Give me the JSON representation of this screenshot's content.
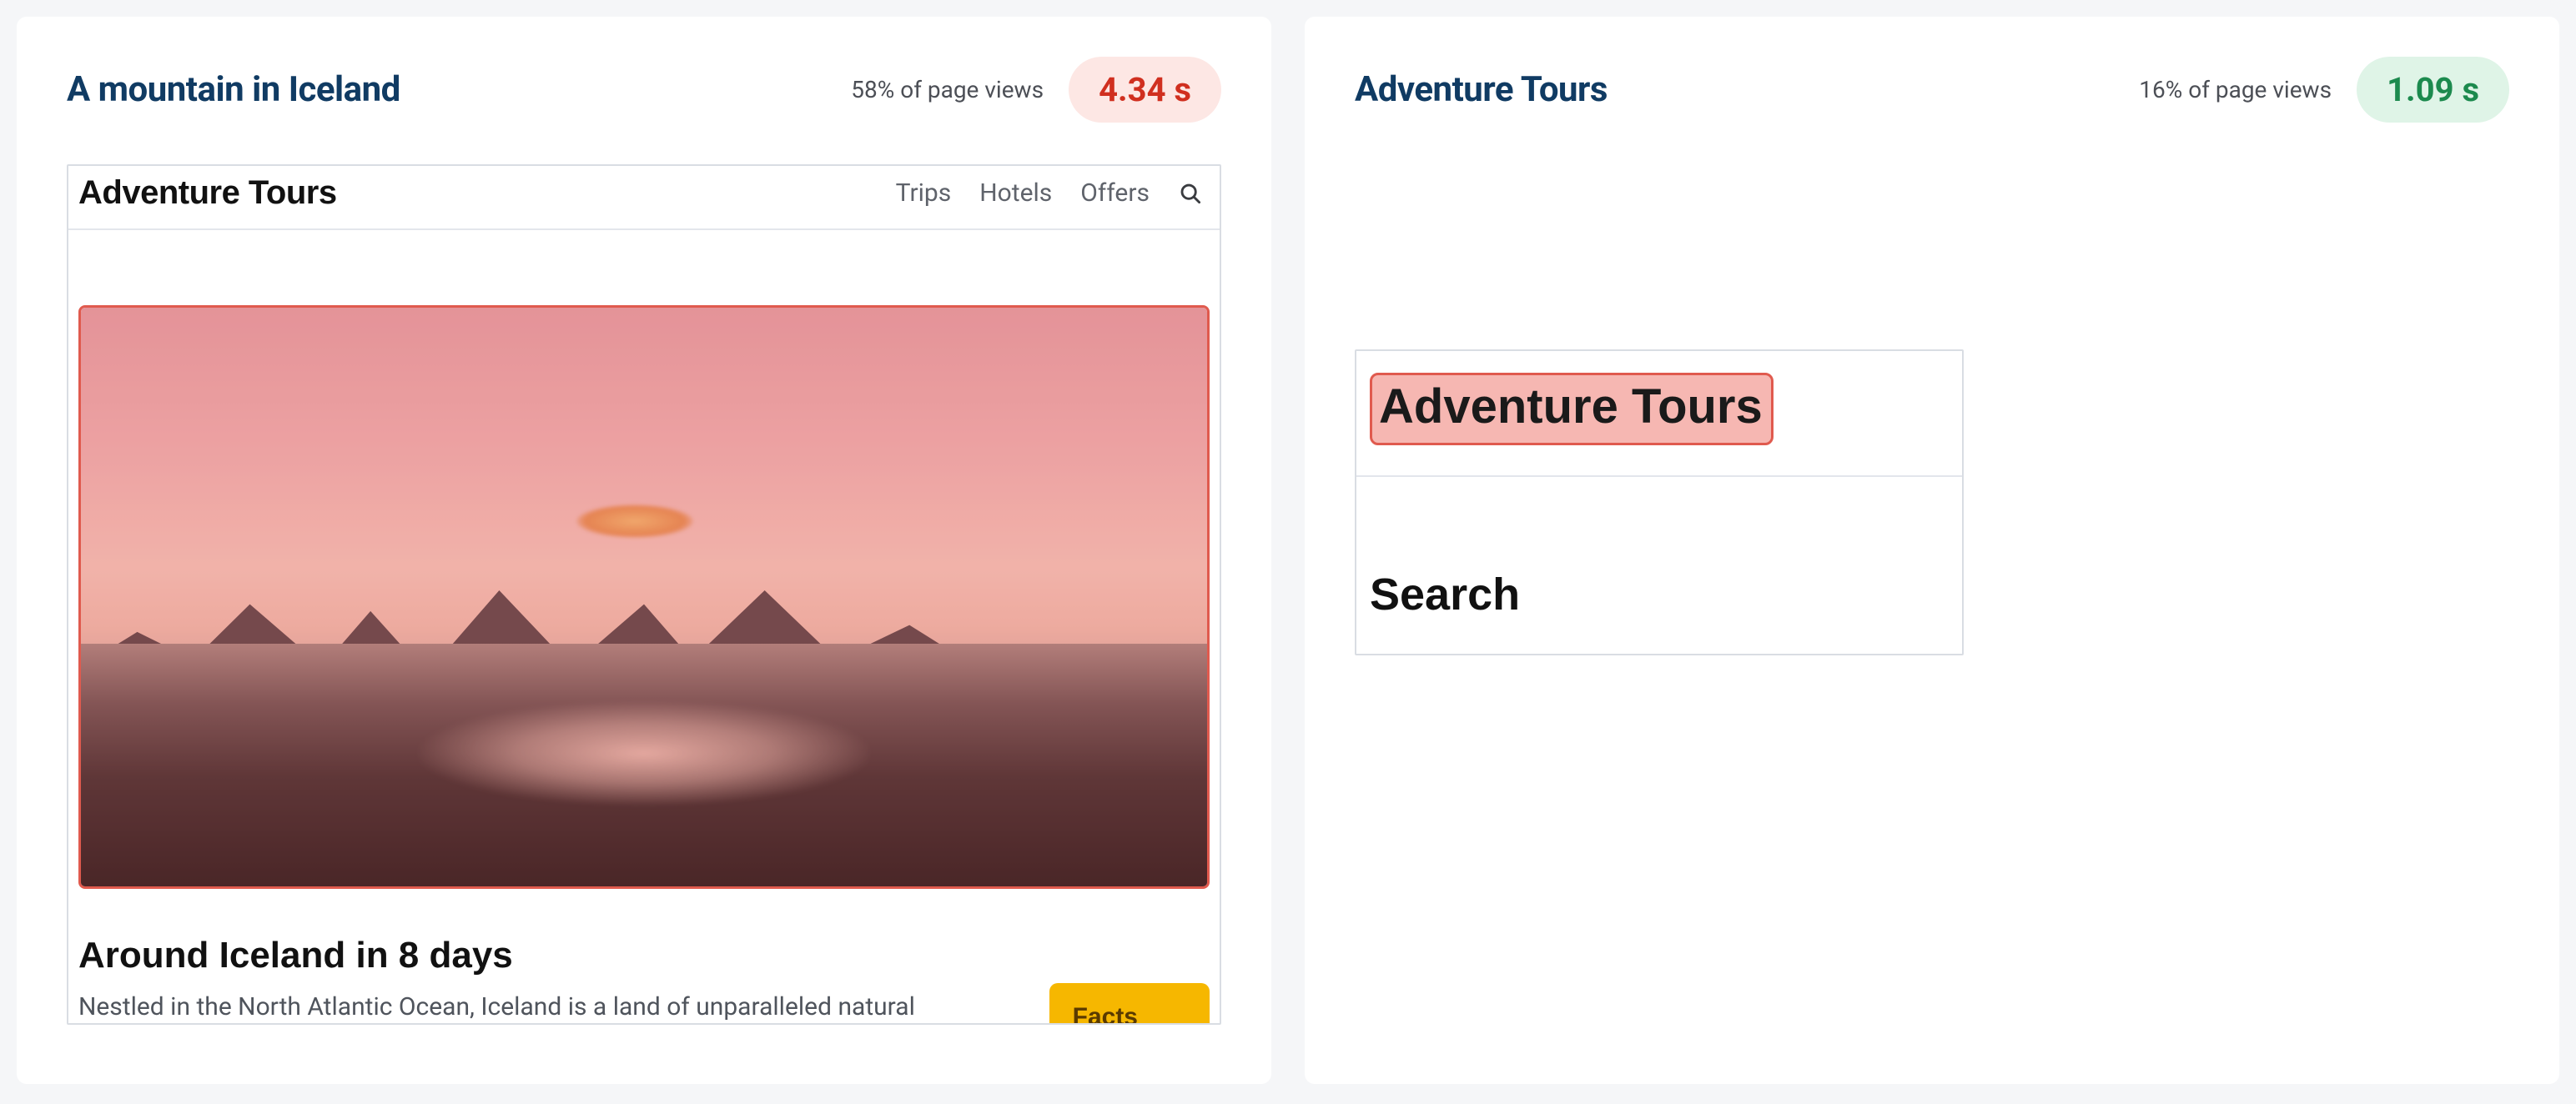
{
  "cards": [
    {
      "title": "A mountain in Iceland",
      "page_views": "58% of page views",
      "metric": "4.34 s",
      "metric_status": "bad",
      "preview": {
        "brand": "Adventure Tours",
        "nav": [
          "Trips",
          "Hotels",
          "Offers"
        ],
        "article_title": "Around Iceland in 8 days",
        "article_desc": "Nestled in the North Atlantic Ocean, Iceland is a land of unparalleled natural",
        "facts_label": "Facts"
      }
    },
    {
      "title": "Adventure Tours",
      "page_views": "16% of page views",
      "metric": "1.09 s",
      "metric_status": "good",
      "preview": {
        "lcp_text": "Adventure Tours",
        "search_label": "Search"
      }
    }
  ]
}
